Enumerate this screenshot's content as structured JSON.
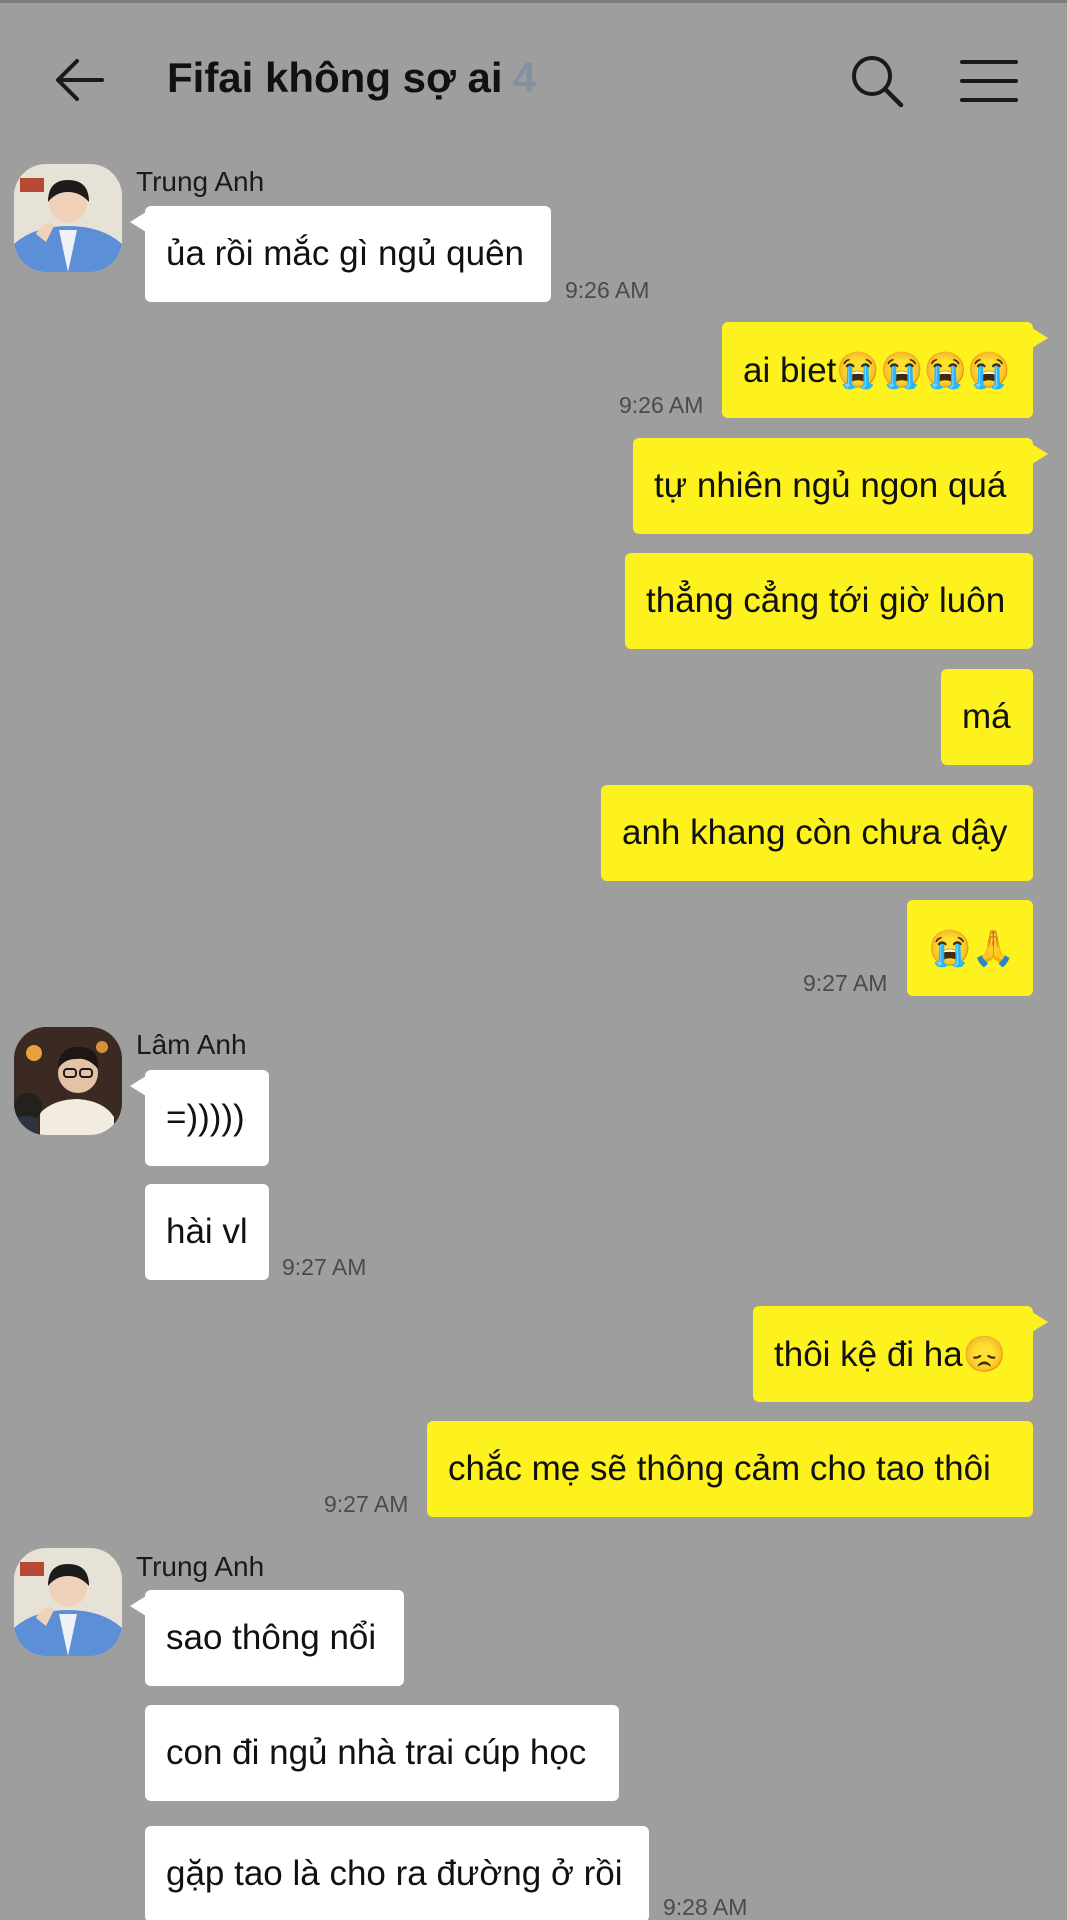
{
  "header": {
    "back_icon": "arrow-left-icon",
    "title": "Fifai không sợ ai",
    "member_count": "4",
    "search_icon": "search-icon",
    "menu_icon": "menu-icon"
  },
  "colors": {
    "background": "#9e9e9e",
    "incoming_bubble": "#ffffff",
    "outgoing_bubble": "#fdf21d",
    "member_count": "#8391a3"
  },
  "messages": [
    {
      "sender": "Trung Anh",
      "text": "ủa rồi mắc gì ngủ quên",
      "time": "9:26 AM"
    },
    {
      "text": "ai biet😭😭😭😭",
      "time": "9:26 AM"
    },
    {
      "text": "tự nhiên ngủ ngon quá"
    },
    {
      "text": "thẳng cẳng tới giờ luôn"
    },
    {
      "text": "má"
    },
    {
      "text": "anh khang còn chưa dậy"
    },
    {
      "text": "😭🙏",
      "time": "9:27 AM"
    },
    {
      "sender": "Lâm Anh",
      "text": "=)))))"
    },
    {
      "text": "hài vl",
      "time": "9:27 AM"
    },
    {
      "text": "thôi kệ đi ha😞"
    },
    {
      "text": "chắc mẹ sẽ thông cảm cho tao thôi",
      "time": "9:27 AM"
    },
    {
      "sender": "Trung Anh",
      "text": "sao thông nổi"
    },
    {
      "text": "con đi ngủ nhà trai cúp học"
    },
    {
      "text": "gặp tao là cho ra đường ở rồi",
      "time": "9:28 AM"
    }
  ]
}
